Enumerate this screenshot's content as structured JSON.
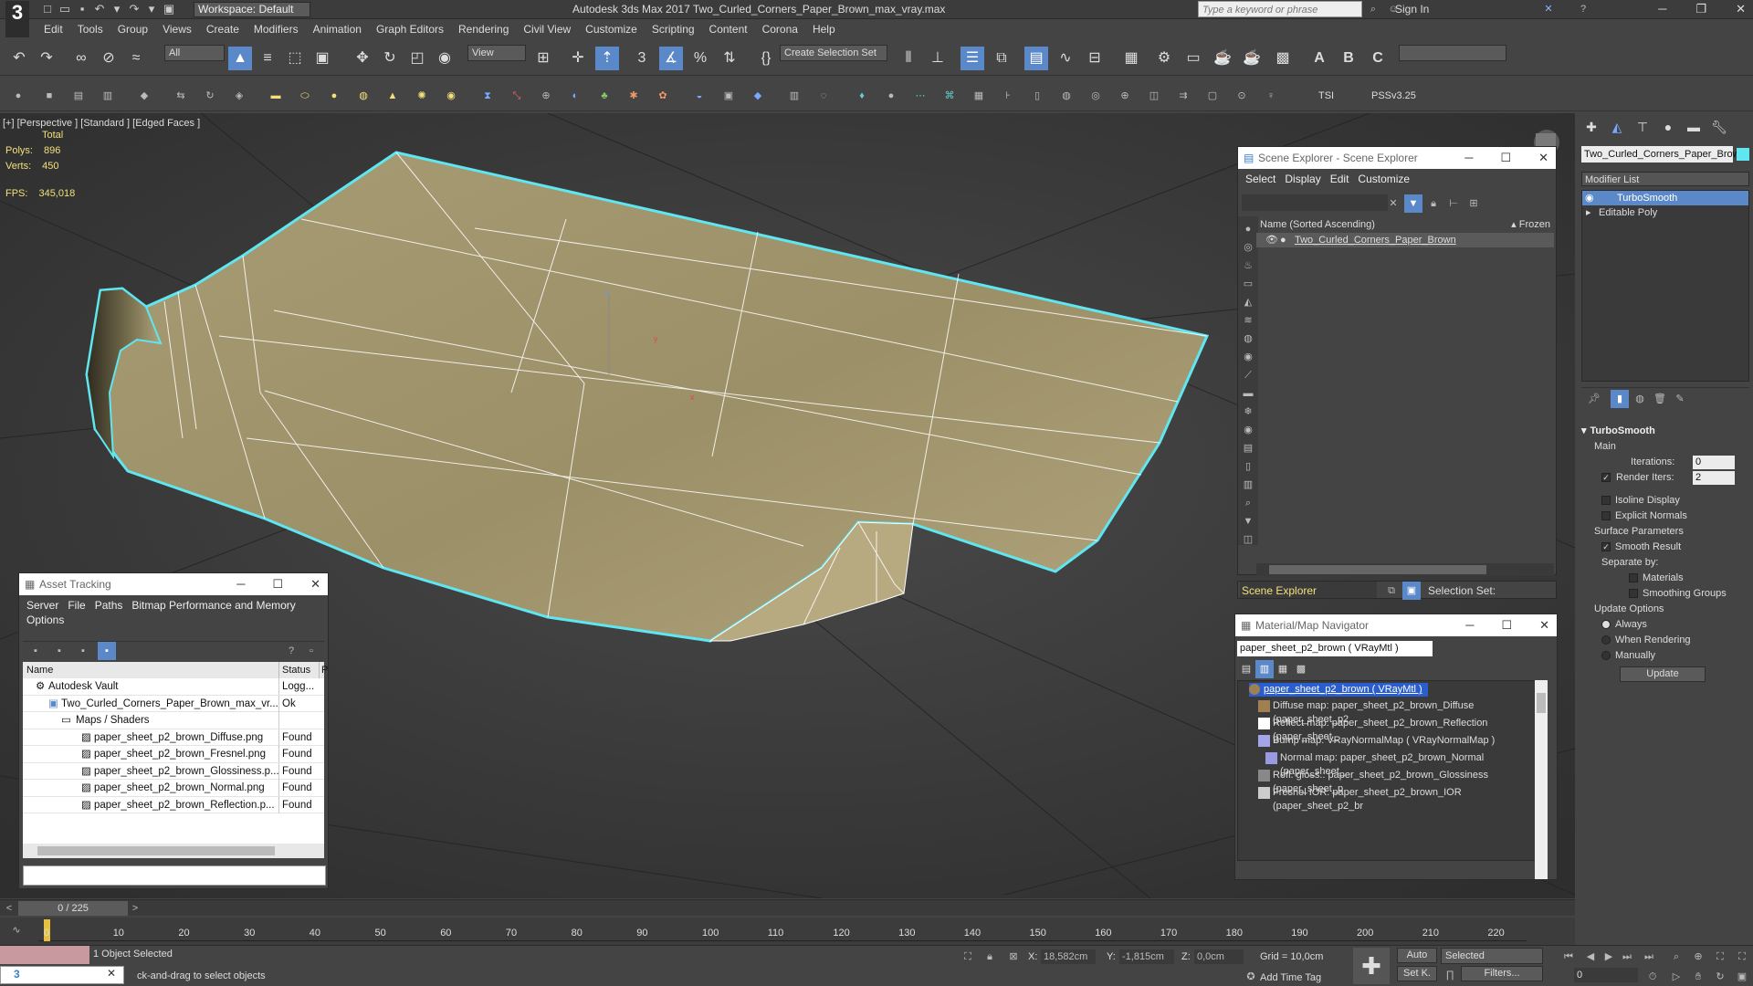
{
  "app": {
    "logo": "3",
    "workspace": "Workspace: Default",
    "title": "Autodesk 3ds Max 2017     Two_Curled_Corners_Paper_Brown_max_vray.max",
    "search_placeholder": "Type a keyword or phrase",
    "sign_in": "Sign In"
  },
  "menu": [
    "Edit",
    "Tools",
    "Group",
    "Views",
    "Create",
    "Modifiers",
    "Animation",
    "Graph Editors",
    "Rendering",
    "Civil View",
    "Customize",
    "Scripting",
    "Content",
    "Corona",
    "Help"
  ],
  "toolbar": {
    "filter": "All",
    "refcoord": "View",
    "selset": "Create Selection Set",
    "tsi": "TSI",
    "pss": "PSSv3.25"
  },
  "viewport": {
    "label": "[+] [Perspective ] [Standard ] [Edged Faces ]",
    "total_label": "Total",
    "polys_label": "Polys:",
    "polys": "896",
    "verts_label": "Verts:",
    "verts": "450",
    "fps_label": "FPS:",
    "fps": "345,018",
    "wire_color": "#5fe6f0",
    "paper_color": "#a09570"
  },
  "scene_explorer": {
    "title": "Scene Explorer - Scene Explorer",
    "menu": [
      "Select",
      "Display",
      "Edit",
      "Customize"
    ],
    "col_name": "Name (Sorted Ascending)",
    "col_frozen": "▴ Frozen",
    "object": "Two_Curled_Corners_Paper_Brown",
    "footer_name": "Scene Explorer",
    "selection_set": "Selection Set:"
  },
  "asset_tracking": {
    "title": "Asset Tracking",
    "menu": [
      "Server",
      "File",
      "Paths",
      "Bitmap Performance and Memory"
    ],
    "menu2": "Options",
    "col_name": "Name",
    "col_status": "Status",
    "col_p": "P",
    "rows": [
      {
        "name": "Autodesk Vault",
        "status": "Logg..."
      },
      {
        "name": "Two_Curled_Corners_Paper_Brown_max_vr...",
        "status": "Ok"
      },
      {
        "name": "Maps / Shaders",
        "status": ""
      },
      {
        "name": "paper_sheet_p2_brown_Diffuse.png",
        "status": "Found"
      },
      {
        "name": "paper_sheet_p2_brown_Fresnel.png",
        "status": "Found"
      },
      {
        "name": "paper_sheet_p2_brown_Glossiness.p...",
        "status": "Found"
      },
      {
        "name": "paper_sheet_p2_brown_Normal.png",
        "status": "Found"
      },
      {
        "name": "paper_sheet_p2_brown_Reflection.p...",
        "status": "Found"
      }
    ]
  },
  "material_nav": {
    "title": "Material/Map Navigator",
    "current": "paper_sheet_p2_brown  ( VRayMtl )",
    "items": [
      {
        "text": "paper_sheet_p2_brown  ( VRayMtl )"
      },
      {
        "text": "Diffuse map: paper_sheet_p2_brown_Diffuse (paper_sheet_p2"
      },
      {
        "text": "Reflect map: paper_sheet_p2_brown_Reflection (paper_sheet_"
      },
      {
        "text": "Bump map: VRayNormalMap  ( VRayNormalMap )"
      },
      {
        "text": "Normal map: paper_sheet_p2_brown_Normal (paper_sheet_"
      },
      {
        "text": "Refl. gloss.: paper_sheet_p2_brown_Glossiness (paper_sheet_p"
      },
      {
        "text": "Fresnel IOR: paper_sheet_p2_brown_IOR (paper_sheet_p2_br"
      }
    ]
  },
  "command_panel": {
    "object_name": "Two_Curled_Corners_Paper_Brown",
    "modifier_list": "Modifier List",
    "stack": [
      "TurboSmooth",
      "Editable Poly"
    ],
    "turbosmooth": {
      "title": "TurboSmooth",
      "main": "Main",
      "iterations_label": "Iterations:",
      "iterations": "0",
      "render_iters_label": "Render Iters:",
      "render_iters": "2",
      "isoline": "Isoline Display",
      "explicit": "Explicit Normals",
      "surface": "Surface Parameters",
      "smooth_result": "Smooth Result",
      "separate": "Separate by:",
      "materials": "Materials",
      "smoothing": "Smoothing Groups",
      "update_options": "Update Options",
      "always": "Always",
      "when_rendering": "When Rendering",
      "manually": "Manually",
      "update": "Update"
    }
  },
  "timeline": {
    "frame": "0 / 225",
    "ticks": [
      "0",
      "10",
      "20",
      "30",
      "40",
      "50",
      "60",
      "70",
      "80",
      "90",
      "100",
      "110",
      "120",
      "130",
      "140",
      "150",
      "160",
      "170",
      "180",
      "190",
      "200",
      "210",
      "220"
    ]
  },
  "status": {
    "selected": "1 Object Selected",
    "prompt": "ck-and-drag to select objects",
    "x_label": "X:",
    "x": "18,582cm",
    "y_label": "Y:",
    "y": "-1,815cm",
    "z_label": "Z:",
    "z": "0,0cm",
    "grid": "Grid = 10,0cm",
    "auto": "Auto",
    "setk": "Set K.",
    "selected_dd": "Selected",
    "filters": "Filters...",
    "add_time_tag": "Add Time Tag",
    "frame_value": "0"
  }
}
